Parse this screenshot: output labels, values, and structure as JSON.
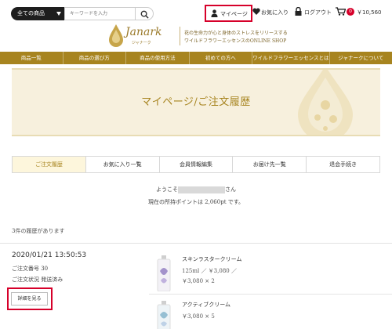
{
  "search": {
    "category_label": "全ての商品",
    "placeholder": "キーワードを入力"
  },
  "header_nav": {
    "mypage": "マイページ",
    "favorites": "お気に入り",
    "logout": "ログアウト",
    "cart_count": "0",
    "cart_total": "￥10,560"
  },
  "logo": {
    "brand": "Janark",
    "brand_kana": "ジャナーク",
    "tagline_1": "花の生命力が心と身体のストレスをリリースする",
    "tagline_2": "ワイルドフラワーエッセンスのONLINE SHOP"
  },
  "main_nav": [
    "商品一覧",
    "商品の選び方",
    "商品の使用方法",
    "初めての方へ",
    "ワイルドフラワーエッセンスとは",
    "ジャナークについて"
  ],
  "banner": {
    "title": "マイページ/ご注文履歴"
  },
  "tabs": [
    "ご注文履歴",
    "お気に入り一覧",
    "会員情報編集",
    "お届け先一覧",
    "退会手続き"
  ],
  "welcome": {
    "prefix": "ようこそ",
    "suffix": "さん",
    "points": "現在の所持ポイントは 2,060pt です。"
  },
  "history_count": "3件の履歴があります",
  "order": {
    "date": "2020/01/21 13:50:53",
    "number": "ご注文番号 30",
    "status": "ご注文状況 発送済み",
    "detail_button": "詳細を見る",
    "items": [
      {
        "name": "スキンラスタークリーム",
        "line1": "125ml ／ ￥3,080 ／",
        "line2": "￥3,080 × 2"
      },
      {
        "name": "アクティブクリーム",
        "line1": "￥3,080 × 5",
        "line2": ""
      }
    ]
  },
  "colors": {
    "accent_gold": "#a7841f",
    "highlight_red": "#d6002a"
  }
}
